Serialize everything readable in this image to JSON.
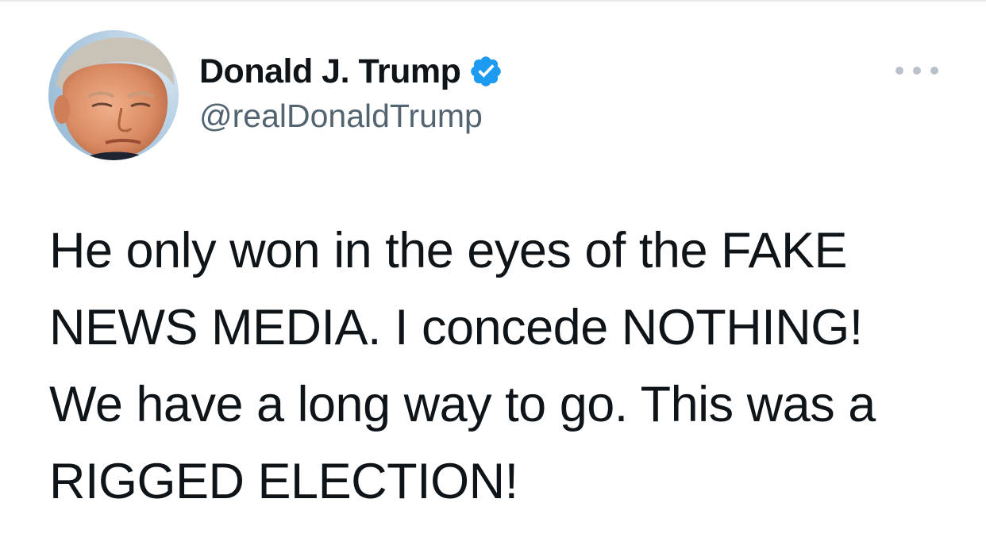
{
  "tweet": {
    "author": {
      "display_name": "Donald J. Trump",
      "handle": "@realDonaldTrump",
      "verified": true,
      "verified_icon": "verified-badge-icon",
      "verified_color": "#1d9bf0"
    },
    "more_icon": "more-horizontal-icon",
    "text_lines": [
      "He only won in the eyes of the FAKE",
      "NEWS MEDIA. I concede NOTHING!",
      "We have a long way to go. This was a",
      "RIGGED ELECTION!"
    ]
  },
  "colors": {
    "text_primary": "#0f1419",
    "text_secondary": "#536471",
    "accent": "#1d9bf0"
  }
}
